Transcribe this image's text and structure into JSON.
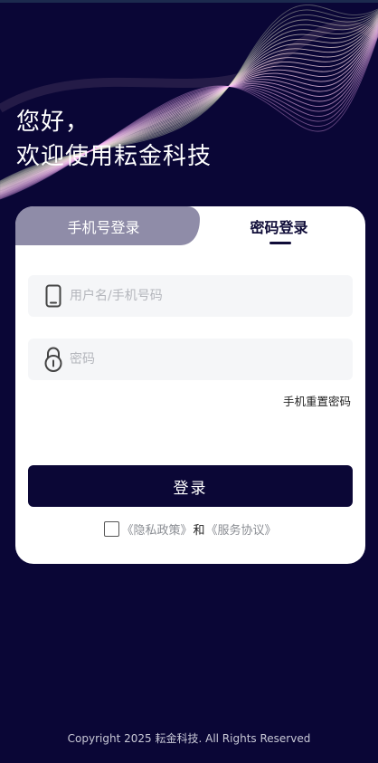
{
  "greeting": {
    "line1": "您好，",
    "line2": "欢迎使用耘金科技"
  },
  "tabs": {
    "phone_login": "手机号登录",
    "password_login": "密码登录",
    "active": "password_login"
  },
  "form": {
    "username": {
      "value": "",
      "placeholder": "用户名/手机号码",
      "icon": "phone-icon"
    },
    "password": {
      "value": "",
      "placeholder": "密码",
      "icon": "lock-icon"
    },
    "reset_link": "手机重置密码",
    "login_label": "登录"
  },
  "agreement": {
    "checked": false,
    "privacy": "《隐私政策》",
    "and": "和",
    "service": "《服务协议》"
  },
  "footer": {
    "copyright": "Copyright 2025 耘金科技. All Rights Reserved"
  },
  "colors": {
    "background": "#0a0636",
    "card": "#ffffff",
    "inactive_tab": "#8f8ca8",
    "primary_button": "#0b0736",
    "input_bg": "#f5f6f8"
  }
}
